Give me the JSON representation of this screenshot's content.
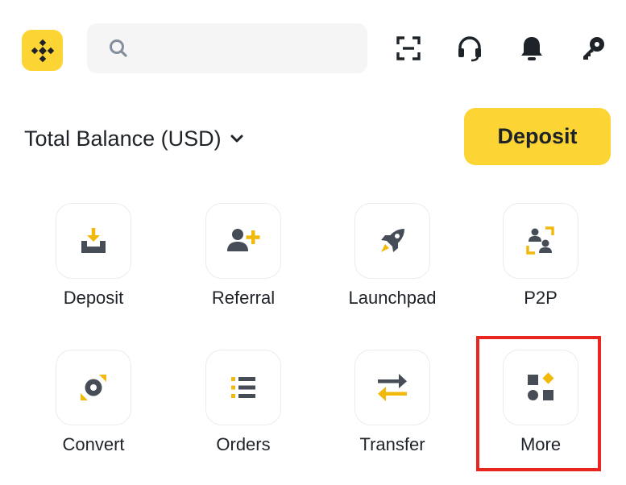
{
  "header": {
    "logo_icon": "binance-logo-icon",
    "search_placeholder": "",
    "search_icon": "search-icon",
    "icons": [
      "scan-icon",
      "headset-icon",
      "bell-icon",
      "key-icon"
    ]
  },
  "balance": {
    "label": "Total Balance (USD)",
    "chevron_icon": "chevron-down-icon"
  },
  "deposit_button": {
    "label": "Deposit"
  },
  "shortcuts": [
    {
      "label": "Deposit",
      "icon": "download-icon"
    },
    {
      "label": "Referral",
      "icon": "add-user-icon"
    },
    {
      "label": "Launchpad",
      "icon": "rocket-icon"
    },
    {
      "label": "P2P",
      "icon": "p2p-icon"
    },
    {
      "label": "Convert",
      "icon": "convert-icon"
    },
    {
      "label": "Orders",
      "icon": "orders-list-icon"
    },
    {
      "label": "Transfer",
      "icon": "transfer-arrows-icon"
    },
    {
      "label": "More",
      "icon": "more-grid-icon"
    }
  ],
  "colors": {
    "brand_yellow": "#fcd535",
    "text_dark": "#1e2329",
    "highlight_red": "#e8261f"
  }
}
